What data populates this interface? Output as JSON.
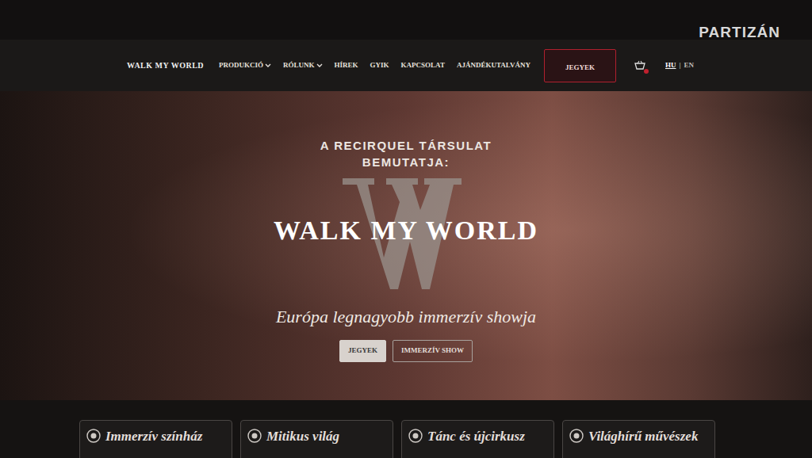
{
  "watermark": "PARTIZÁN",
  "nav": {
    "logo": "WALK MY WORLD",
    "items": [
      {
        "label": "PRODUKCIÓ",
        "kind": "dropdown"
      },
      {
        "label": "RÓLUNK",
        "kind": "dropdown"
      },
      {
        "label": "HÍREK",
        "kind": "link"
      },
      {
        "label": "GYIK",
        "kind": "link"
      },
      {
        "label": "KAPCSOLAT",
        "kind": "link"
      },
      {
        "label": "AJÁNDÉKUTALVÁNY",
        "kind": "link"
      }
    ],
    "tickets": "JEGYEK",
    "languages": [
      {
        "label": "HU",
        "selected": true
      },
      {
        "label": "EN",
        "selected": false
      }
    ],
    "separator": "|"
  },
  "hero": {
    "kicker": [
      "A RECIRQUEL TÁRSULAT",
      "BEMUTATJA:"
    ],
    "title": "WALK MY WORLD",
    "subtitle": "Európa legnagyobb immerzív showja",
    "buttons": [
      {
        "label": "JEGYEK",
        "kind": "filled"
      },
      {
        "label": "IMMERZÍV SHOW",
        "kind": "outline"
      }
    ]
  },
  "features": [
    {
      "label": "Immerzív színház"
    },
    {
      "label": "Mitikus világ"
    },
    {
      "label": "Tánc és újcirkusz"
    },
    {
      "label": "Világhírű művészek"
    }
  ]
}
